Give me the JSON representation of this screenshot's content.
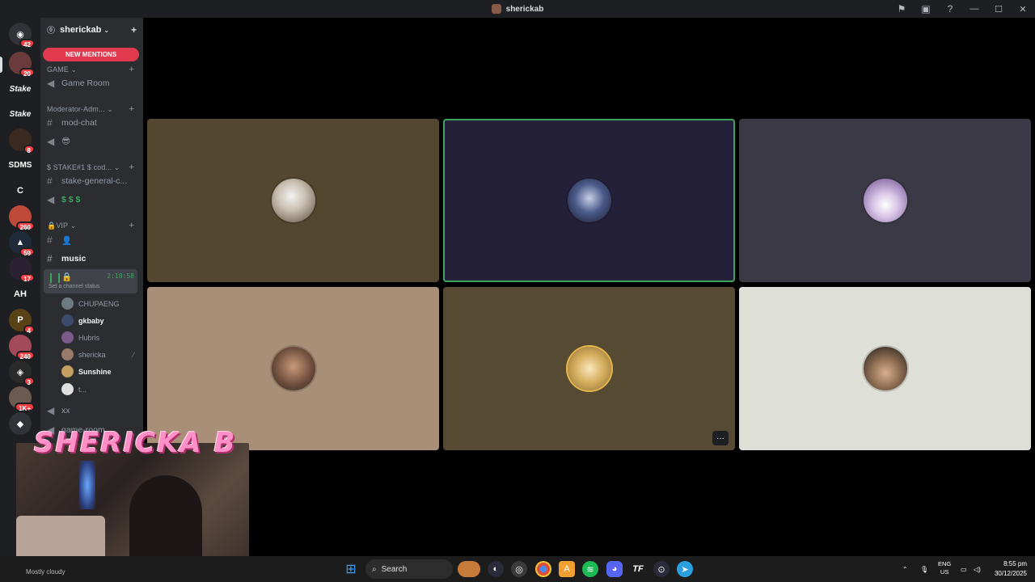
{
  "window": {
    "title": "sherickab"
  },
  "server": {
    "name": "sherickab",
    "new_mentions": "NEW MENTIONS"
  },
  "rail": {
    "badges": [
      "42",
      "20",
      "8",
      "260",
      "59",
      "17",
      "4",
      "240",
      "3",
      "1K+"
    ],
    "text_servers": [
      "Stake",
      "Stake",
      "SDMS",
      "C",
      "AH"
    ]
  },
  "categories": {
    "game": "GAME",
    "moderator": "Moderator-Adm...",
    "stake": "$ STAKE#1 $ cod...",
    "vip": "VIP"
  },
  "channels": {
    "game_room": "Game Room",
    "mod_chat": "mod-chat",
    "emoji_voice": "😎",
    "stake_general": "stake-general-c...",
    "dollars": "$ $ $",
    "music": "music",
    "xx": "xx",
    "game_room_2": "game-room"
  },
  "voice": {
    "timer": "2:18:58",
    "status": "Set a channel status",
    "users": [
      "CHUPAENG",
      "gkbaby",
      "Hubris",
      "shericka",
      "Sunshine",
      "t..."
    ]
  },
  "stream": {
    "overlay_name": "SHERICKA B"
  },
  "taskbar": {
    "search": "Search",
    "lang_line1": "ENG",
    "lang_line2": "US",
    "time": "8:55 pm",
    "date": "30/12/2025",
    "weather": "Mostly cloudy"
  },
  "colors": {
    "speaking": "#3ba55d",
    "mention": "#e13a4f",
    "tile1": "#54472f",
    "tile2": "#24203a",
    "tile3": "#3b3946",
    "tile4": "#a98f78",
    "tile5": "#574a33",
    "tile6": "#dedfd6"
  }
}
